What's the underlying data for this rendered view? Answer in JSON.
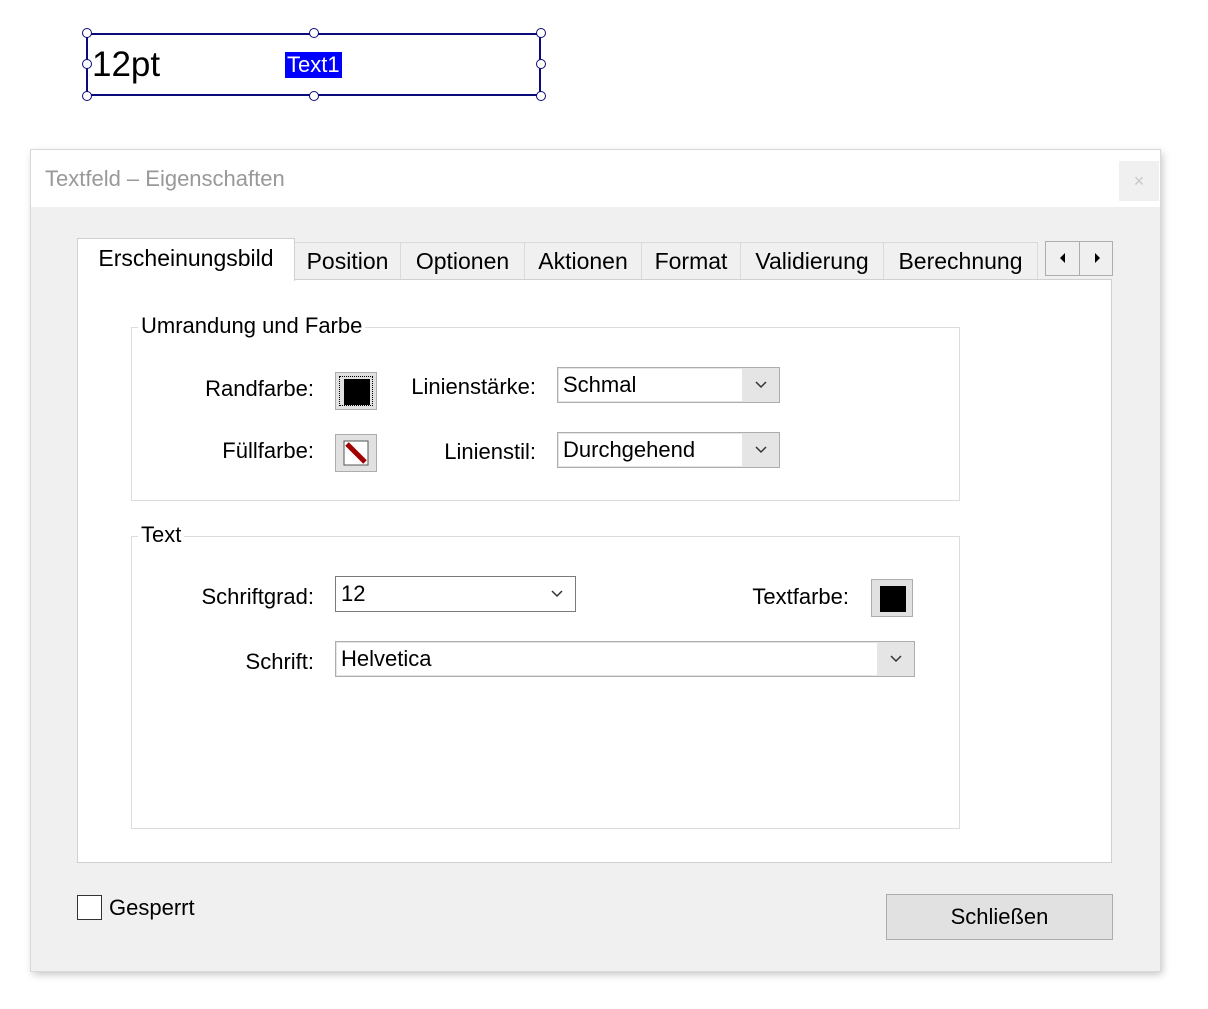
{
  "page_field": {
    "font_size_label": "12pt",
    "field_name": "Text1"
  },
  "dialog": {
    "title": "Textfeld – Eigenschaften",
    "close_glyph": "×",
    "tabs": [
      {
        "label": "Erscheinungsbild",
        "active": true
      },
      {
        "label": "Position"
      },
      {
        "label": "Optionen"
      },
      {
        "label": "Aktionen"
      },
      {
        "label": "Format"
      },
      {
        "label": "Validierung"
      },
      {
        "label": "Berechnung"
      }
    ],
    "tab_scroll": {
      "left": "◀",
      "right": "▶"
    },
    "border_group": {
      "title": "Umrandung und Farbe",
      "border_color_label": "Randfarbe:",
      "border_color": "#000000",
      "fill_color_label": "Füllfarbe:",
      "fill_color_icon": "no-color-icon",
      "line_width_label": "Linienstärke:",
      "line_width_value": "Schmal",
      "line_style_label": "Linienstil:",
      "line_style_value": "Durchgehend"
    },
    "text_group": {
      "title": "Text",
      "font_size_label": "Schriftgrad:",
      "font_size_value": "12",
      "text_color_label": "Textfarbe:",
      "text_color": "#000000",
      "font_label": "Schrift:",
      "font_value": "Helvetica"
    },
    "locked_label": "Gesperrt",
    "locked_checked": false,
    "close_button_label": "Schließen"
  }
}
